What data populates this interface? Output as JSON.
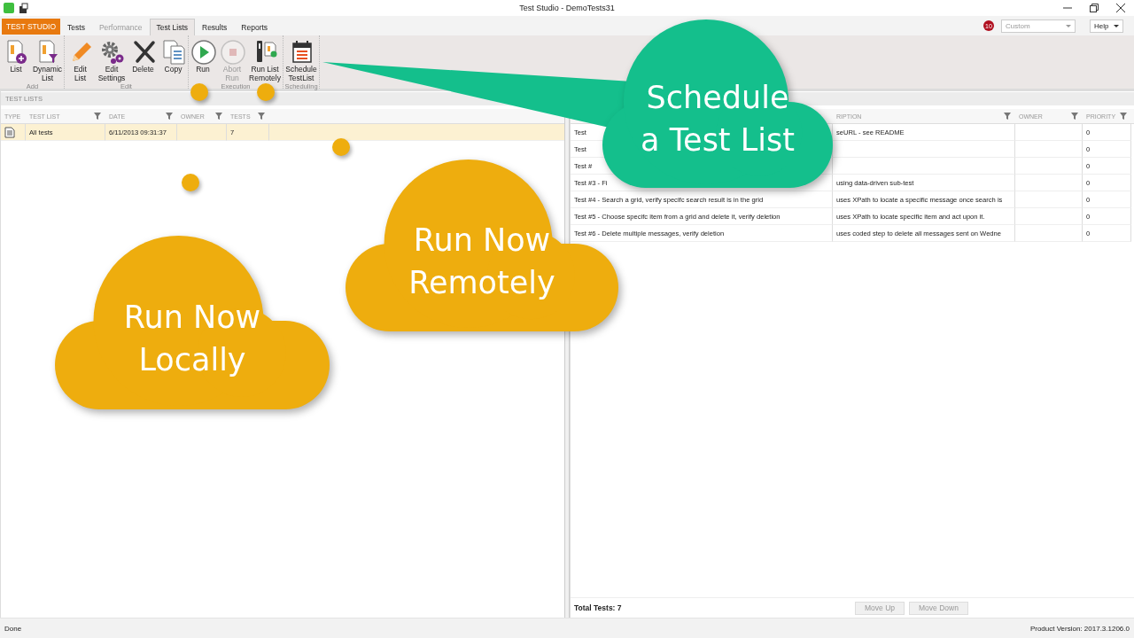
{
  "window": {
    "title": "Test Studio - DemoTests31"
  },
  "app_button": "TEST STUDIO",
  "tabs": [
    {
      "label": "Tests",
      "selected": false,
      "disabled": false
    },
    {
      "label": "Performance",
      "selected": false,
      "disabled": true
    },
    {
      "label": "Test Lists",
      "selected": true,
      "disabled": false
    },
    {
      "label": "Results",
      "selected": false,
      "disabled": false
    },
    {
      "label": "Reports",
      "selected": false,
      "disabled": false
    }
  ],
  "notification_count": "10",
  "profile_dropdown": {
    "value": "Custom",
    "disabled": true
  },
  "help_button": "Help",
  "ribbon": {
    "groups": [
      {
        "caption": "Add",
        "buttons": [
          {
            "lines": [
              "List"
            ],
            "disabled": false
          },
          {
            "lines": [
              "Dynamic",
              "List"
            ],
            "disabled": false
          }
        ]
      },
      {
        "caption": "Edit",
        "buttons": [
          {
            "lines": [
              "Edit",
              "List"
            ],
            "disabled": false
          },
          {
            "lines": [
              "Edit",
              "Settings"
            ],
            "disabled": false
          },
          {
            "lines": [
              "Delete"
            ],
            "disabled": false
          },
          {
            "lines": [
              "Copy"
            ],
            "disabled": false
          }
        ]
      },
      {
        "caption": "Execution",
        "buttons": [
          {
            "lines": [
              "Run"
            ],
            "disabled": false
          },
          {
            "lines": [
              "Abort",
              "Run"
            ],
            "disabled": true
          },
          {
            "lines": [
              "Run List",
              "Remotely"
            ],
            "disabled": false
          }
        ]
      },
      {
        "caption": "Scheduling",
        "buttons": [
          {
            "lines": [
              "Schedule",
              "TestList"
            ],
            "disabled": false
          }
        ]
      }
    ]
  },
  "test_lists": {
    "title": "TEST LISTS",
    "columns": [
      {
        "label": "TYPE",
        "filter": false
      },
      {
        "label": "TEST LIST",
        "filter": true
      },
      {
        "label": "DATE",
        "filter": true
      },
      {
        "label": "OWNER",
        "filter": true
      },
      {
        "label": "TESTS",
        "filter": true
      }
    ],
    "rows": [
      {
        "test_list": "All tests",
        "date": "6/11/2013 09:31:37",
        "tests": "7",
        "selected": true
      }
    ]
  },
  "tests": {
    "columns": [
      {
        "label": "RIPTION",
        "filter": true
      },
      {
        "label": "OWNER",
        "filter": true
      },
      {
        "label": "PRIORITY",
        "filter": true
      }
    ],
    "rows": [
      {
        "column_1": "Test",
        "column_2": "seURL - see README",
        "priority": "0"
      },
      {
        "column_1": "Test",
        "priority": "0"
      },
      {
        "column_1": "Test #",
        "priority": "0"
      },
      {
        "column_1": "Test #3 - Fi",
        "column_2": "using data-driven sub-test",
        "priority": "0"
      },
      {
        "column_1": "Test #4 - Search a grid, verify specifc search result is in the grid",
        "column_2": "uses XPath to locate a specific message once search is",
        "priority": "0"
      },
      {
        "column_1": "Test #5 - Choose specifc item from a grid and delete it, verify deletion",
        "column_2": "uses XPath to locate specific item and act upon it.",
        "priority": "0"
      },
      {
        "column_1": "Test #6 - Delete multiple messages, verify deletion",
        "column_2": "uses coded step to delete all messages sent on Wedne",
        "priority": "0"
      }
    ],
    "total": "Total Tests: 7",
    "buttons": [
      {
        "label": "Move Up",
        "disabled": true
      },
      {
        "label": "Move Down",
        "disabled": true
      }
    ]
  },
  "status_bar": {
    "message": "Done",
    "version": "Product Version: 2017.3.1206.0"
  },
  "callouts": [
    {
      "lines": [
        "Schedule",
        "a Test List"
      ],
      "color": "#14bf8c"
    },
    {
      "lines": [
        "Run Now",
        "Remotely"
      ],
      "color": "#eead0e"
    },
    {
      "lines": [
        "Run Now",
        "Locally"
      ],
      "color": "#eead0e"
    }
  ]
}
